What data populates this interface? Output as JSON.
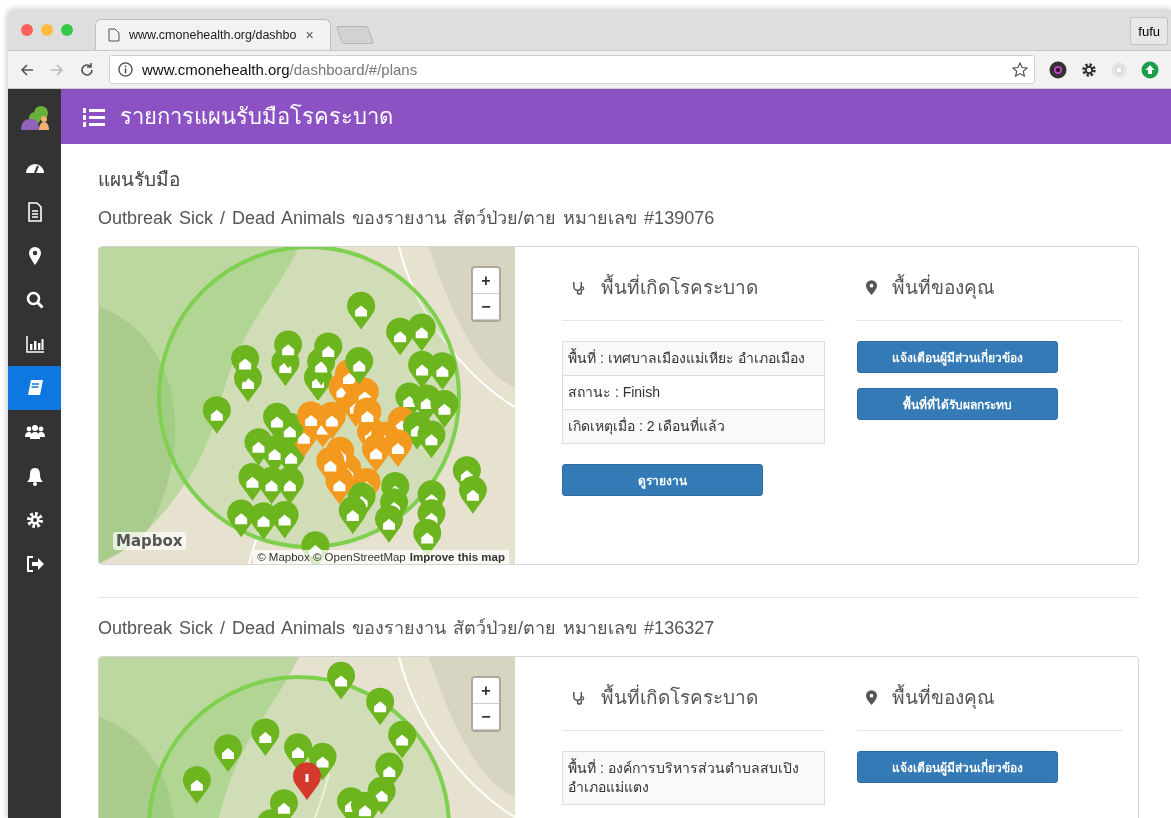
{
  "browser": {
    "tab_title": "www.cmonehealth.org/dashbo",
    "tab_close": "×",
    "profile": "fufu",
    "url_host": "www.cmonehealth.org",
    "url_path": "/dashboard/#/plans"
  },
  "sidebar": {
    "items": [
      {
        "selected": false
      },
      {
        "selected": false
      },
      {
        "selected": false
      },
      {
        "selected": false
      },
      {
        "selected": false
      },
      {
        "selected": true
      },
      {
        "selected": false
      },
      {
        "selected": false
      },
      {
        "selected": false
      },
      {
        "selected": false
      }
    ]
  },
  "header": {
    "title": "รายการแผนรับมือโรคระบาด"
  },
  "section_title": "แผนรับมือ",
  "plans": [
    {
      "title": "Outbreak Sick / Dead Animals ของรายงาน สัตว์ป่วย/ตาย หมายเลข #139076",
      "map": {
        "zoom_in": "+",
        "zoom_out": "−",
        "logo": "Mapbox",
        "attribution": "© Mapbox © OpenStreetMap",
        "improve_link": "Improve this map"
      },
      "outbreak_heading": "พื้นที่เกิดโรคระบาด",
      "info_rows": [
        "พื้นที่ : เทศบาลเมืองแม่เหียะ อำเภอเมือง",
        "สถานะ : Finish",
        "เกิดเหตุเมื่อ : 2 เดือนที่แล้ว"
      ],
      "report_button": "ดูรายงาน",
      "your_area_heading": "พื้นที่ของคุณ",
      "actions": [
        "แจ้งเตือนผู้มีส่วนเกี่ยวข้อง",
        "พื้นที่ที่ได้รับผลกระทบ"
      ]
    },
    {
      "title": "Outbreak Sick / Dead Animals ของรายงาน สัตว์ป่วย/ตาย หมายเลข #136327",
      "map": {
        "zoom_in": "+",
        "zoom_out": "−"
      },
      "outbreak_heading": "พื้นที่เกิดโรคระบาด",
      "info_rows": [
        "พื้นที่ : องค์การบริหารส่วนตำบลสบเปิง อำเภอแม่แตง"
      ],
      "your_area_heading": "พื้นที่ของคุณ",
      "actions": [
        "แจ้งเตือนผู้มีส่วนเกี่ยวข้อง"
      ]
    }
  ]
}
